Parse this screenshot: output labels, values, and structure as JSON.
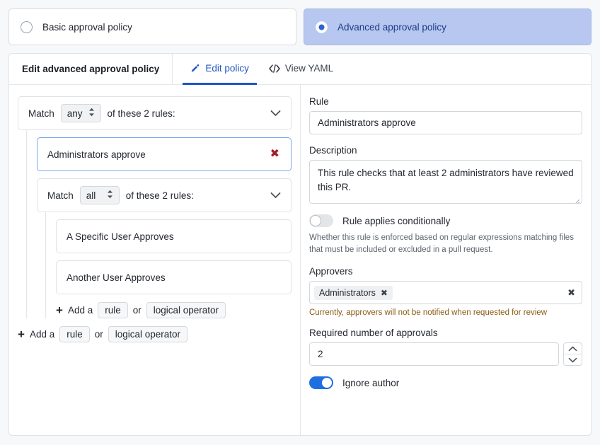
{
  "policy_options": [
    {
      "label": "Basic approval policy",
      "selected": false
    },
    {
      "label": "Advanced approval policy",
      "selected": true
    }
  ],
  "panel": {
    "title": "Edit advanced approval policy",
    "tabs": [
      {
        "label": "Edit policy",
        "icon": "pencil-icon",
        "active": true
      },
      {
        "label": "View YAML",
        "icon": "code-icon",
        "active": false
      }
    ]
  },
  "rule_tree": {
    "root": {
      "match_prefix": "Match",
      "match_value": "any",
      "match_suffix": "of these 2 rules:"
    },
    "selected_rule": "Administrators approve",
    "nested": {
      "match_prefix": "Match",
      "match_value": "all",
      "match_suffix": "of these 2 rules:",
      "rules": [
        "A Specific User Approves",
        "Another User Approves"
      ]
    },
    "add_row": {
      "prefix": "Add a",
      "rule_label": "rule",
      "or_label": "or",
      "operator_label": "logical operator"
    }
  },
  "form": {
    "rule_label": "Rule",
    "rule_value": "Administrators approve",
    "description_label": "Description",
    "description_value": "This rule checks that at least 2 administrators have reviewed this PR.",
    "conditional_toggle_label": "Rule applies conditionally",
    "conditional_toggle_on": false,
    "conditional_help": "Whether this rule is enforced based on regular expressions matching files that must be included or excluded in a pull request.",
    "approvers_label": "Approvers",
    "approver_chips": [
      "Administrators"
    ],
    "approvers_warning": "Currently, approvers will not be notified when requested for review",
    "approvals_label": "Required number of approvals",
    "approvals_value": "2",
    "ignore_author_label": "Ignore author",
    "ignore_author_on": true
  },
  "colors": {
    "accent": "#1f55c4",
    "selected_card_bg": "#b7c7ef",
    "toggle_on": "#1f6fe0",
    "delete_red": "#a02128",
    "warning": "#8a5a12"
  }
}
